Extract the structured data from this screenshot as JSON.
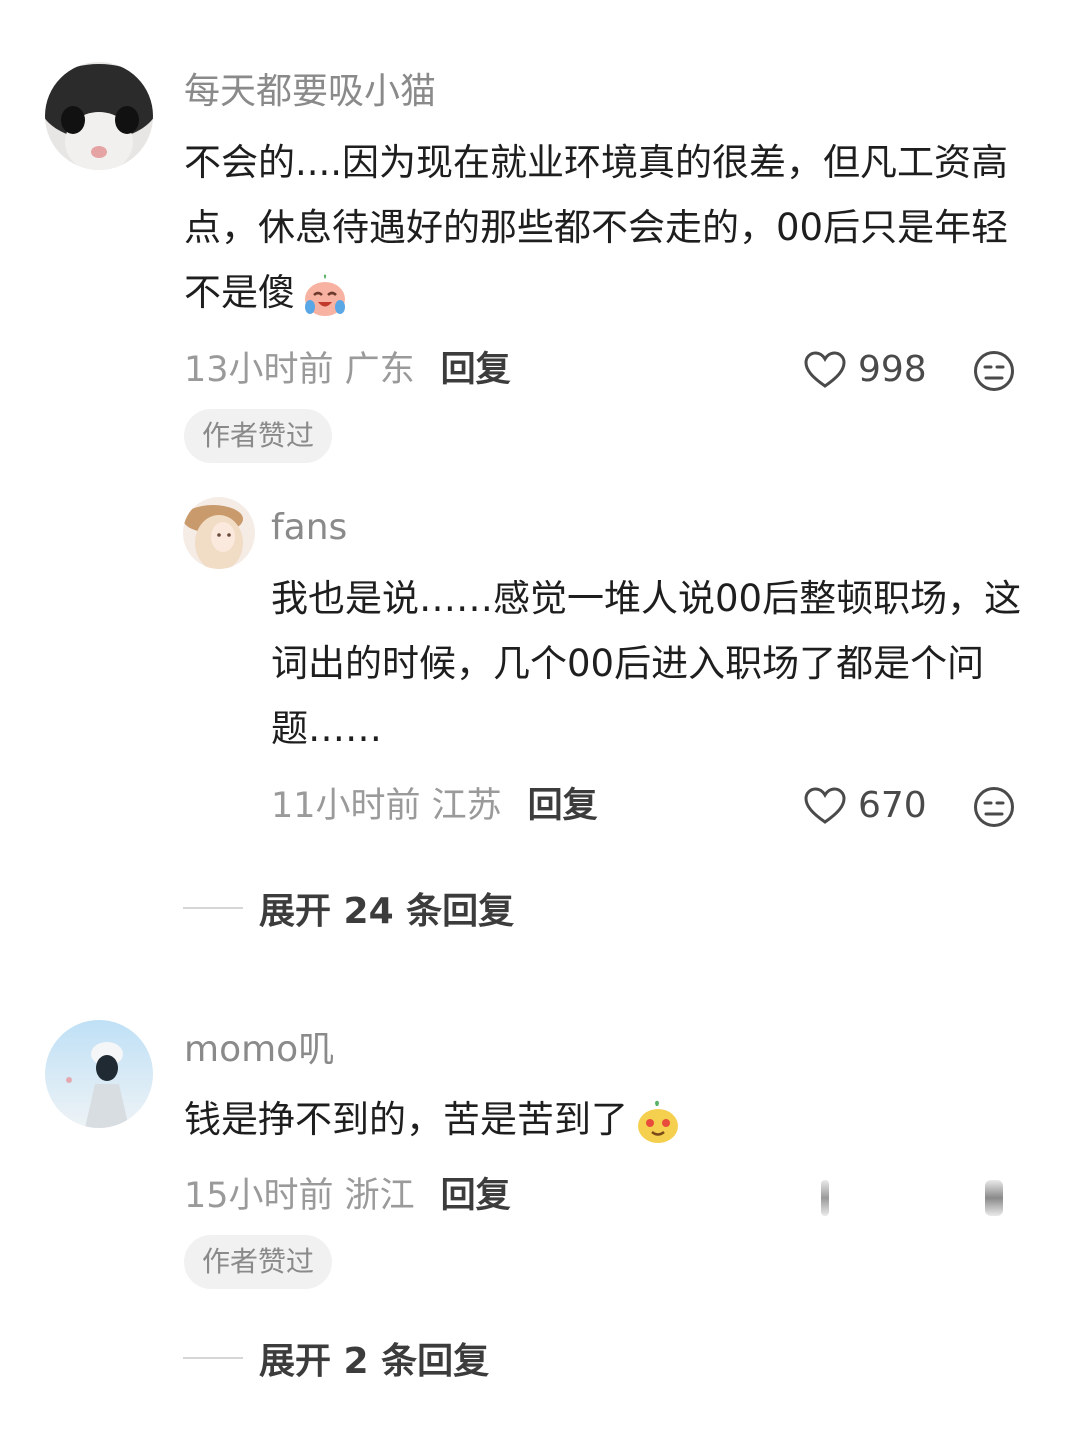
{
  "comments": [
    {
      "username": "每天都要吸小猫",
      "text": "不会的....因为现在就业环境真的很差，但凡工资高点，休息待遇好的那些都不会走的，00后只是年轻不是傻",
      "emoji": "crying-laughing-emoji",
      "time_location": "13小时前 广东",
      "reply_label": "回复",
      "likes": "998",
      "badge": "作者赞过",
      "replies": [
        {
          "username": "fans",
          "text": "我也是说……感觉一堆人说00后整顿职场，这词出的时候，几个00后进入职场了都是个问题……",
          "time_location": "11小时前 江苏",
          "reply_label": "回复",
          "likes": "670"
        }
      ],
      "expand_label": "展开 24 条回复"
    },
    {
      "username": "momo叽",
      "text": "钱是挣不到的，苦是苦到了",
      "emoji": "smug-face-emoji",
      "time_location": "15小时前 浙江",
      "reply_label": "回复",
      "badge": "作者赞过",
      "expand_label": "展开 2 条回复"
    }
  ],
  "colors": {
    "username": "#8a8a8a",
    "meta": "#9a9a9a",
    "badge_bg": "#f1f1f1"
  }
}
